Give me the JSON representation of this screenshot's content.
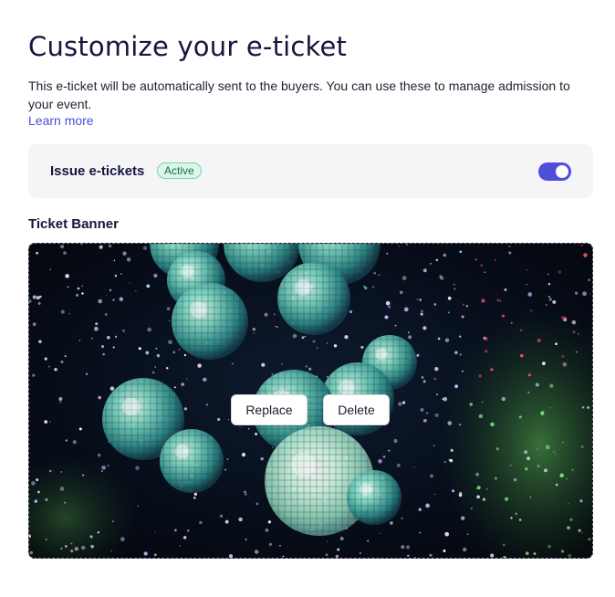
{
  "header": {
    "title": "Customize your e-ticket",
    "description": "This e-ticket will be automatically sent to the buyers. You can use these to manage admission to your event.",
    "learn_more": "Learn more"
  },
  "issue": {
    "label": "Issue e-tickets",
    "status": "Active",
    "enabled": true
  },
  "banner": {
    "label": "Ticket Banner",
    "replace_label": "Replace",
    "delete_label": "Delete"
  },
  "colors": {
    "accent": "#4f4ddc",
    "link": "#4b50d8",
    "badge_bg": "#dcf6ea",
    "badge_text": "#11703f"
  }
}
